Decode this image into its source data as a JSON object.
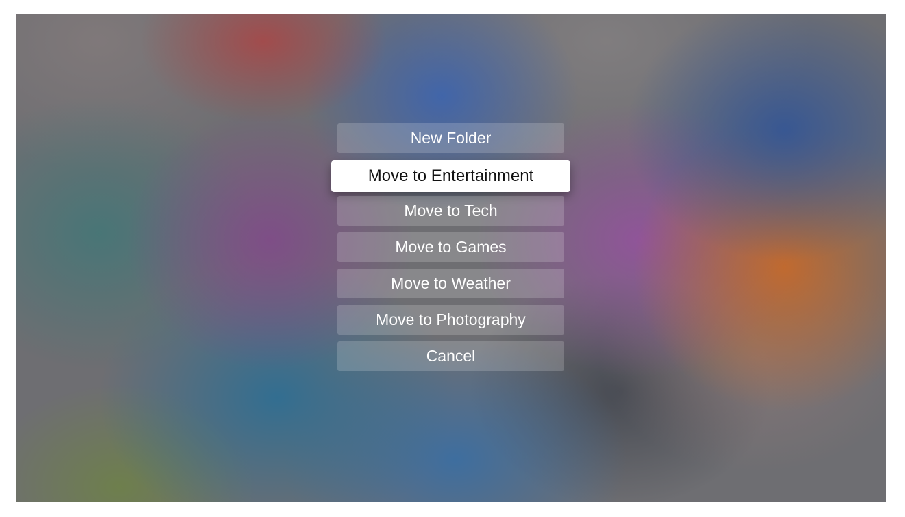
{
  "menu": {
    "focused_index": 1,
    "items": [
      {
        "label": "New Folder"
      },
      {
        "label": "Move to Entertainment"
      },
      {
        "label": "Move to Tech"
      },
      {
        "label": "Move to Games"
      },
      {
        "label": "Move to Weather"
      },
      {
        "label": "Move to Photography"
      },
      {
        "label": "Cancel"
      }
    ]
  },
  "colors": {
    "focused_background": "#ffffff",
    "focused_text": "#111111",
    "item_text": "#ffffff"
  }
}
